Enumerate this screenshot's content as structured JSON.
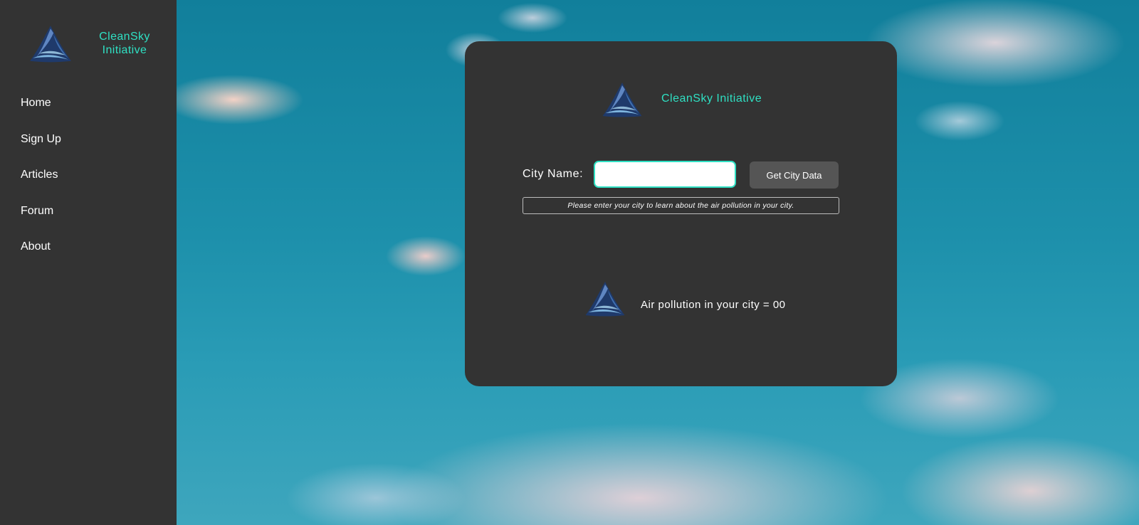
{
  "brand": {
    "name_line1": "CleanSky",
    "name_line2": "Initiative",
    "full_name": "CleanSky Initiative",
    "logo_icon": "triangle-wave-logo-icon",
    "accent_color": "#2fe0c3"
  },
  "nav": {
    "items": [
      {
        "label": "Home"
      },
      {
        "label": "Sign Up"
      },
      {
        "label": "Articles"
      },
      {
        "label": "Forum"
      },
      {
        "label": "About"
      }
    ]
  },
  "form": {
    "city_label": "City Name:",
    "city_value": "",
    "button_label": "Get City Data",
    "hint": "Please enter your city to learn about the air pollution in your city."
  },
  "result": {
    "text": "Air pollution in your city = 00"
  },
  "colors": {
    "sidebar_bg": "#333333",
    "card_bg": "#333333",
    "button_bg": "#555555"
  }
}
